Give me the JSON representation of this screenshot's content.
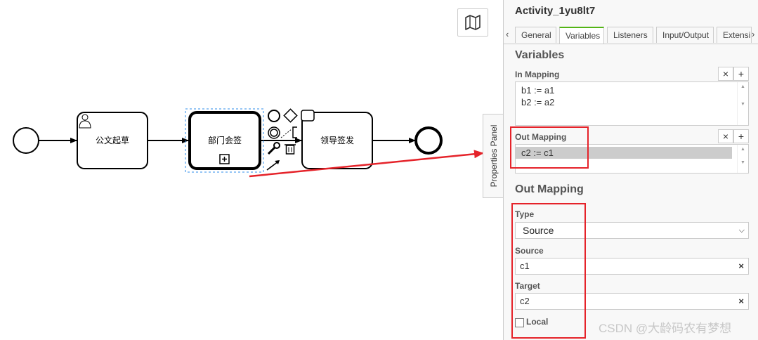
{
  "diagram": {
    "tasks": [
      {
        "label": "公文起草"
      },
      {
        "label": "部门会签"
      },
      {
        "label": "领导签发"
      }
    ]
  },
  "canvas": {
    "minimap_icon": "map-icon",
    "panel_toggle_label": "Properties Panel"
  },
  "panel": {
    "title": "Activity_1yu8lt7",
    "tabs": [
      "General",
      "Variables",
      "Listeners",
      "Input/Output",
      "Extensi"
    ],
    "active_tab": "Variables",
    "section_title": "Variables",
    "in_mapping": {
      "label": "In Mapping",
      "items": [
        "b1 := a1",
        "b2 := a2"
      ]
    },
    "out_mapping": {
      "label": "Out Mapping",
      "items": [
        "c2 := c1"
      ]
    },
    "detail": {
      "title": "Out Mapping",
      "type_label": "Type",
      "type_value": "Source",
      "source_label": "Source",
      "source_value": "c1",
      "target_label": "Target",
      "target_value": "c2",
      "local_label": "Local"
    }
  },
  "watermark": "CSDN @大龄码农有梦想",
  "colors": {
    "accent_tab": "#52b415",
    "highlight": "#e5232a",
    "selection": "#2d8ceb"
  }
}
